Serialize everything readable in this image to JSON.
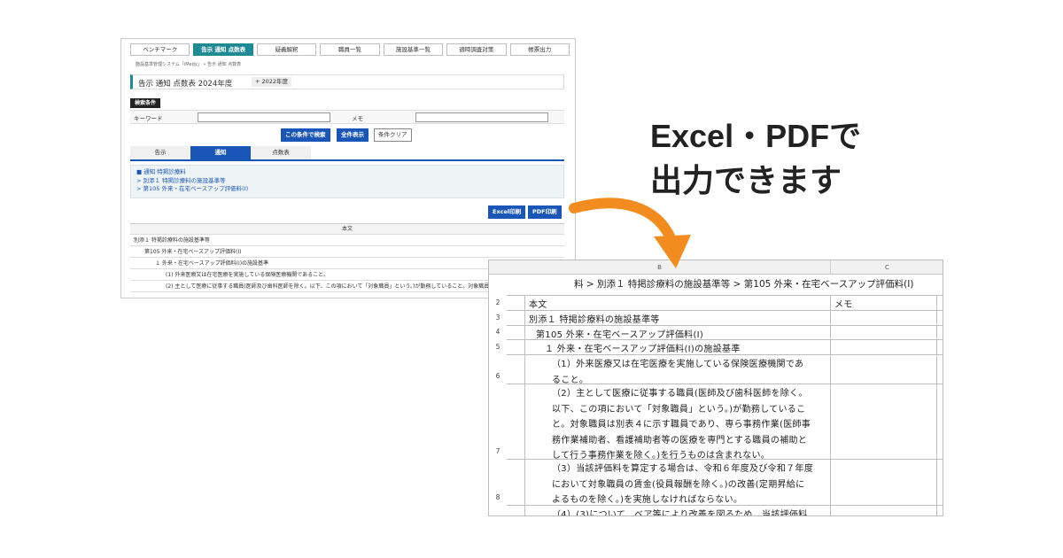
{
  "headline": {
    "line1": "Excel・PDFで",
    "line2": "出力できます"
  },
  "colors": {
    "teal": "#1f8a94",
    "blue": "#1a56b8",
    "arrow": "#f28c1e"
  },
  "webapp": {
    "nav_tabs": [
      {
        "label": "ベンチマーク"
      },
      {
        "label": "告示 通知 点数表",
        "active": true
      },
      {
        "label": "疑義解釈"
      },
      {
        "label": "職員一覧"
      },
      {
        "label": "施設基準一覧"
      },
      {
        "label": "適時調査対策"
      },
      {
        "label": "帳票出力"
      }
    ],
    "breadcrumb": "施設基準管理システム「iMedy」 » 告示 通知 点数表",
    "title": "告示 通知 点数表 2024年度",
    "year_chip": "+ 2022年度",
    "search": {
      "section_label": "検索条件",
      "keyword_label": "キーワード",
      "memo_label": "メモ",
      "search_button": "この条件で検索",
      "show_all_button": "全件表示",
      "clear_button": "条件クリア"
    },
    "subtabs": [
      {
        "label": "告示"
      },
      {
        "label": "通知",
        "active": true
      },
      {
        "label": "点数表"
      }
    ],
    "crumbs": [
      "■ 通知 特掲診療料",
      "> 別添１ 特掲診療料の施設基準等",
      "> 第105 外来・在宅ベースアップ評価料(Ⅰ)"
    ],
    "excel_button": "Excel印刷",
    "pdf_button": "PDF印刷",
    "grid_header": "本文",
    "grid_rows": [
      "別添１ 特掲診療料の施設基準等",
      "第105 外来・在宅ベースアップ評価料(Ⅰ)",
      "１ 外来・在宅ベースアップ評価料(Ⅰ)の施設基準",
      "(1) 外来医療又は在宅医療を実施している保険医療機関であること。",
      "(2) 主として医療に従事する職員(医師及び歯科医師を除く。以下、この項において「対象職員」という。)が勤務していること。対象職員は別表４に示す"
    ]
  },
  "sheet": {
    "col_heads": [
      "B",
      "C"
    ],
    "row1_text": "料 > 別添１ 特掲診療料の施設基準等 > 第105 外来・在宅ベースアップ評価料(Ⅰ)",
    "rows": [
      {
        "num": "2",
        "b": "本文",
        "c": "メモ"
      },
      {
        "num": "3",
        "b": "別添１ 特掲診療料の施設基準等",
        "c": ""
      },
      {
        "num": "4",
        "b": "第105 外来・在宅ベースアップ評価料(Ⅰ)",
        "c": ""
      },
      {
        "num": "5",
        "b": "１ 外来・在宅ベースアップ評価料(Ⅰ)の施設基準",
        "c": ""
      },
      {
        "num": "6",
        "b": "（1）外来医療又は在宅医療を実施している保険医療機関であ\nること。",
        "c": ""
      },
      {
        "num": "7",
        "b": "（2）主として医療に従事する職員(医師及び歯科医師を除く。\n以下、この項において「対象職員」という。)が勤務しているこ\nと。対象職員は別表４に示す職員であり、専ら事務作業(医師事\n務作業補助者、看護補助者等の医療を専門とする職員の補助と\nして行う事務作業を除く。)を行うものは含まれない。",
        "c": ""
      },
      {
        "num": "8",
        "b": "（3）当該評価料を算定する場合は、令和６年度及び令和７年度\nにおいて対象職員の賃金(役員報酬を除く。)の改善(定期昇給に\nよるものを除く。)を実施しなければならない。",
        "c": ""
      },
      {
        "num": "",
        "b": "（4）(3)について、ベア等により改善を図るため、当該評価料",
        "c": ""
      }
    ]
  }
}
